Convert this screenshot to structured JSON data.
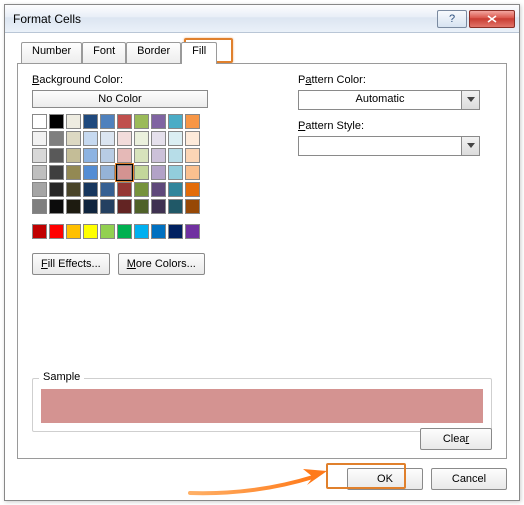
{
  "window": {
    "title": "Format Cells"
  },
  "tabs": {
    "items": [
      "Number",
      "Font",
      "Border",
      "Fill"
    ],
    "active": 3
  },
  "labels": {
    "backgroundColor": "Background Color:",
    "noColor": "No Color",
    "fillEffects": "Fill Effects...",
    "moreColors": "More Colors...",
    "patternColor": "Pattern Color:",
    "patternStyle": "Pattern Style:",
    "automatic": "Automatic",
    "sample": "Sample",
    "clear": "Clear",
    "ok": "OK",
    "cancel": "Cancel"
  },
  "colors": {
    "sample": "#d49391",
    "selected": "#d49391",
    "grid": [
      "#ffffff",
      "#000000",
      "#eeece1",
      "#1f497d",
      "#4f81bd",
      "#c0504d",
      "#9bbb59",
      "#8064a2",
      "#4bacc6",
      "#f79646",
      "#f2f2f2",
      "#7f7f7f",
      "#ddd9c3",
      "#c6d9f0",
      "#dbe5f1",
      "#f2dcdb",
      "#ebf1dd",
      "#e5e0ec",
      "#dbeef3",
      "#fdeada",
      "#d8d8d8",
      "#595959",
      "#c4bd97",
      "#8db3e2",
      "#b8cce4",
      "#e5b9b7",
      "#d7e3bc",
      "#ccc1d9",
      "#b7dde8",
      "#fbd5b5",
      "#bfbfbf",
      "#3f3f3f",
      "#938953",
      "#548dd4",
      "#95b3d7",
      "#d49391",
      "#c3d69b",
      "#b2a2c7",
      "#92cddc",
      "#fac08f",
      "#a5a5a5",
      "#262626",
      "#494429",
      "#17365d",
      "#366092",
      "#953734",
      "#76923c",
      "#5f497a",
      "#31859b",
      "#e36c09",
      "#7f7f7f",
      "#0c0c0c",
      "#1d1b10",
      "#0f243e",
      "#244061",
      "#632423",
      "#4f6128",
      "#3f3151",
      "#205867",
      "#974806"
    ],
    "standard": [
      "#c00000",
      "#ff0000",
      "#ffc000",
      "#ffff00",
      "#92d050",
      "#00b050",
      "#00b0f0",
      "#0070c0",
      "#002060",
      "#7030a0"
    ]
  }
}
